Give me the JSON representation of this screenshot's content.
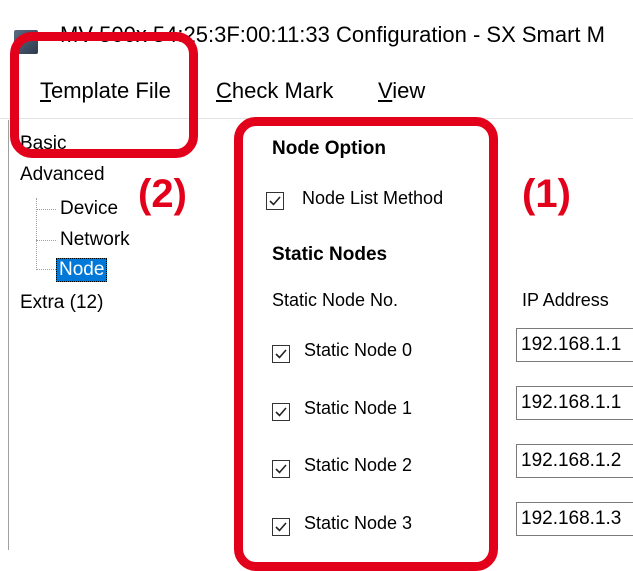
{
  "window": {
    "title": "MV-500x 54:25:3F:00:11:33 Configuration - SX Smart M",
    "icon": "app-icon"
  },
  "menu": {
    "template_file": {
      "ul": "T",
      "rest": "emplate File"
    },
    "check_mark": {
      "ul": "C",
      "rest": "heck Mark"
    },
    "view": {
      "ul": "V",
      "rest": "iew"
    }
  },
  "tree": {
    "basic": "Basic",
    "advanced": "Advanced",
    "device": "Device",
    "network": "Network",
    "node": "Node",
    "extra": "Extra (12)"
  },
  "node_option": {
    "heading": "Node Option",
    "node_list_method": {
      "label": "Node List Method",
      "checked": true
    }
  },
  "static_nodes": {
    "heading": "Static Nodes",
    "col_node_no": "Static Node No.",
    "col_ip": "IP Address",
    "rows": [
      {
        "label": "Static Node 0",
        "checked": true,
        "ip": "192.168.1.1"
      },
      {
        "label": "Static Node 1",
        "checked": true,
        "ip": "192.168.1.1"
      },
      {
        "label": "Static Node 2",
        "checked": true,
        "ip": "192.168.1.2"
      },
      {
        "label": "Static Node 3",
        "checked": true,
        "ip": "192.168.1.3"
      }
    ]
  },
  "annotations": {
    "label_1": "(1)",
    "label_2": "(2)",
    "color": "#e3001b"
  },
  "colors": {
    "selection": "#0078d7"
  }
}
